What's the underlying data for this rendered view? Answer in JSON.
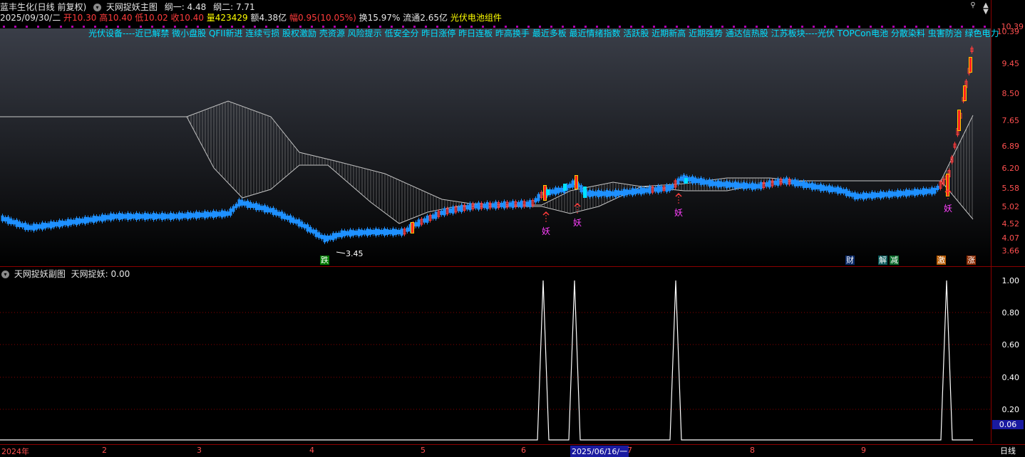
{
  "header": {
    "stock": "蓝丰生化(日线 前复权)",
    "indicator_main": "天网捉妖主图",
    "gang1": "纲一: 4.48",
    "gang2": "纲二: 7.71",
    "date": "2025/09/30/二",
    "open": "开10.30",
    "high": "高10.40",
    "low": "低10.02",
    "close": "收10.40",
    "volume": "量423429",
    "amount": "额4.38亿",
    "change": "幅0.95(10.05%)",
    "turnover": "换15.97%",
    "float": "流通2.65亿",
    "sector": "光伏电池组件"
  },
  "concepts": "光伏设备----近已解禁 微小盘股 QFII新进 连续亏损 股权激励 壳资源 风险提示 低安全分 昨日涨停 昨日连板 昨高换手 最近多板 最近情绪指数 活跃股 近期新高 近期强势 通达信热股 江苏板块----光伏 TOPCon电池 分散染料 虫害防治 绿色电力",
  "main_axis": [
    "10.39",
    "9.45",
    "8.50",
    "7.65",
    "6.89",
    "6.20",
    "5.58",
    "5.02",
    "4.52",
    "4.07",
    "3.66"
  ],
  "sub_axis": [
    "1.00",
    "0.80",
    "0.60",
    "0.40",
    "0.20"
  ],
  "current_price": "10.39",
  "current_sub": "0.06",
  "sub_title": "天网捉妖副图",
  "sub_value": "天网捉妖: 0.00",
  "low_mark": "3.45",
  "yao": "妖",
  "tags": {
    "die": "跌",
    "cai": "财",
    "jie": "解",
    "jian": "减",
    "ji": "激",
    "zhang": "涨"
  },
  "x_axis": [
    "2024年",
    "2",
    "3",
    "4",
    "5",
    "6",
    "2025/06/16/一",
    "7",
    "8",
    "9"
  ],
  "timeframe": "日线",
  "colors": {
    "up": "#ff3b3b",
    "down": "#00e0ff",
    "band": "#bbbbbb",
    "accent": "#ffff00"
  }
}
